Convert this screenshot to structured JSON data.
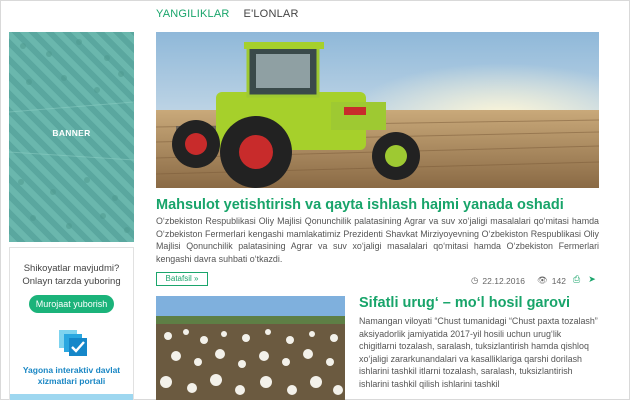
{
  "tabs": [
    {
      "label": "YANGILIKLAR",
      "active": true
    },
    {
      "label": "E'LONLAR",
      "active": false
    }
  ],
  "sidebar": {
    "banner_label": "BANNER",
    "complaint_text": "Shikoyatlar mavjudmi? Onlayn tarzda yuboring",
    "appeal_button": "Murojaat yuborish",
    "portal_text": "Yagona interaktiv davlat xizmatlari portali",
    "portal_icon": "checkbox-icon"
  },
  "articles": [
    {
      "title": "Mahsulot yetishtirish va qayta ishlash hajmi yanada oshadi",
      "excerpt": "O‘zbekiston Respublikasi Oliy Majlisi Qonunchilik palatasining Agrar va suv xo‘jaligi masalalari qo‘mitasi hamda O‘zbekiston Fermerlari kengashi mamlakatimiz Prezidenti Shavkat Mirziyoyevning O‘zbekiston Respublikasi Oliy Majlisi Qonunchilik palatasining Agrar va suv xo‘jaligi masalalari qo‘mitasi hamda O‘zbekiston Fermerlari kengashi davra suhbati o‘tkazdi.",
      "more_label": "Batafsil »",
      "date": "22.12.2016",
      "views": "142",
      "image": "tractor-field-image"
    },
    {
      "title": "Sifatli urug‘ – mo‘l hosil garovi",
      "excerpt": "Namangan viloyati “Chust tumanidagi “Chust paxta tozalash” aksiyadorlik jamiyatida 2017-yil hosili uchun urug‘lik chigitlarni tozalash, saralash, tuksizlantirish hamda qishloq xo‘jaligi zararkunandalari va kasalliklariga qarshi dorilash ishlarini tashkil itlarni tozalash, saralash, tuksizlantirish ishlarini tashkil qilish ishlarini tashkil",
      "image": "cotton-field-image"
    }
  ],
  "colors": {
    "accent": "#18a46a",
    "link_blue": "#1a87c4"
  }
}
